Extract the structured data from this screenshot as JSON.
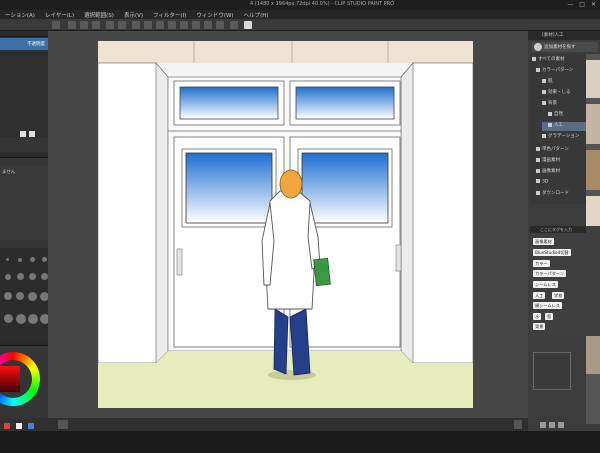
{
  "window": {
    "title": "4 (1480 x 1964px 72dpi 40.0%)  - CLIP STUDIO PAINT PRO",
    "controls": [
      "—",
      "□",
      "✕"
    ]
  },
  "menu": [
    "ーション(A)",
    "レイヤー(L)",
    "選択範囲(S)",
    "表示(V)",
    "フィルター(I)",
    "ウィンドウ(W)",
    "ヘルプ(H)"
  ],
  "left_panel": {
    "layer_row_text": "不透明度",
    "nav_text": "ません"
  },
  "material_panel": {
    "tab_label": "[素材]人工",
    "search_label": "追加素材を探す",
    "tree": [
      {
        "label": "すべての素材",
        "selected": false
      },
      {
        "label": "カラーパターン",
        "selected": false
      },
      {
        "label": "肌",
        "selected": false
      },
      {
        "label": "効果・しる",
        "selected": false
      },
      {
        "label": "背景",
        "selected": false
      },
      {
        "label": "自然",
        "selected": false
      },
      {
        "label": "人工",
        "selected": true
      },
      {
        "label": "グラデーション",
        "selected": false
      },
      {
        "label": "単色パターン",
        "selected": false
      },
      {
        "label": "漫画素材",
        "selected": false
      },
      {
        "label": "画像素材",
        "selected": false
      },
      {
        "label": "3D",
        "selected": false
      },
      {
        "label": "ダウンロード",
        "selected": false
      }
    ],
    "tag_header": "ここにタグを入力",
    "tags": [
      "画像素材",
      "BlueStudio4切替",
      "カラー",
      "カラーパターン",
      "シームレス",
      "人工",
      "学校",
      "横シームレス",
      "水",
      "窓",
      "背景"
    ]
  },
  "colors": {
    "accent": "#3d6fa8",
    "sky_top": "#1e6fd0",
    "sky_bottom": "#ffffff",
    "ceiling": "#ece4d0",
    "floor": "#e6ecbc",
    "hair": "#f0a63c",
    "coat": "#ffffff",
    "pants": "#24408a",
    "book": "#3a9a44"
  }
}
